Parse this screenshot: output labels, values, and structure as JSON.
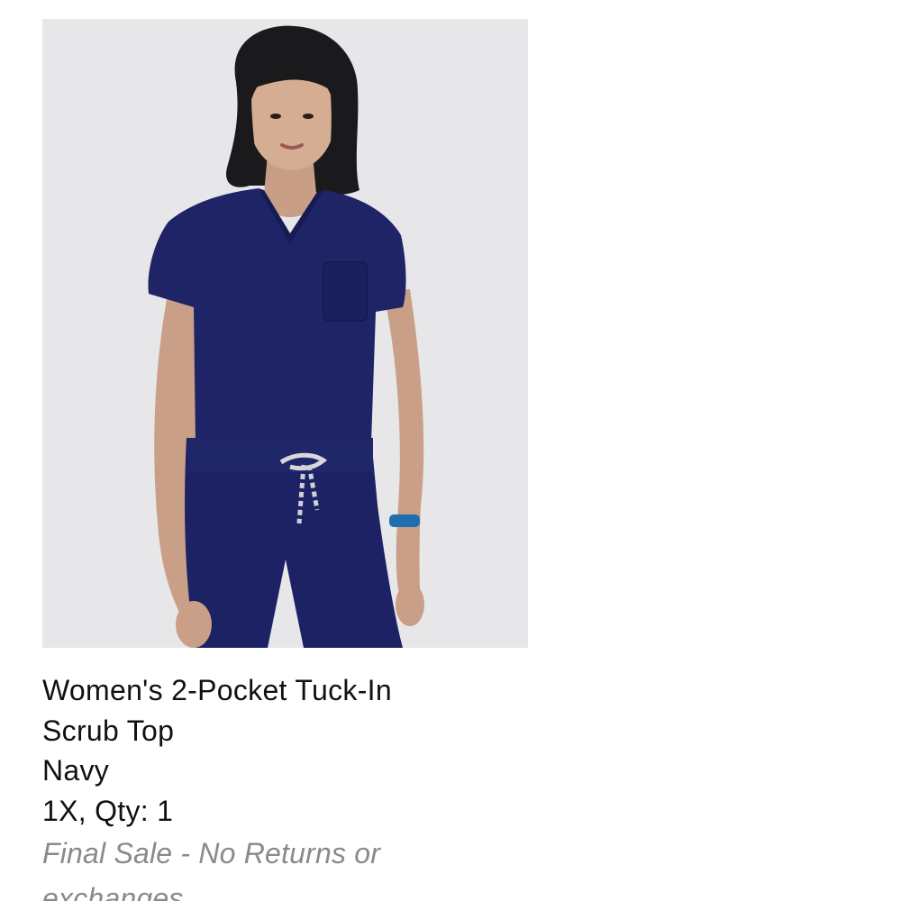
{
  "product": {
    "image_alt": "Woman wearing a navy V-neck scrub top and navy jogger scrub pants",
    "title": "Women's 2-Pocket Tuck-In Scrub Top",
    "color": "Navy",
    "size_qty": "1X, Qty: 1",
    "sale_notice": "Final Sale - No Returns or exchanges",
    "colors": {
      "garment": "#1e2466",
      "background": "#e6e6e8",
      "notice_text": "#8a8a8a"
    }
  }
}
